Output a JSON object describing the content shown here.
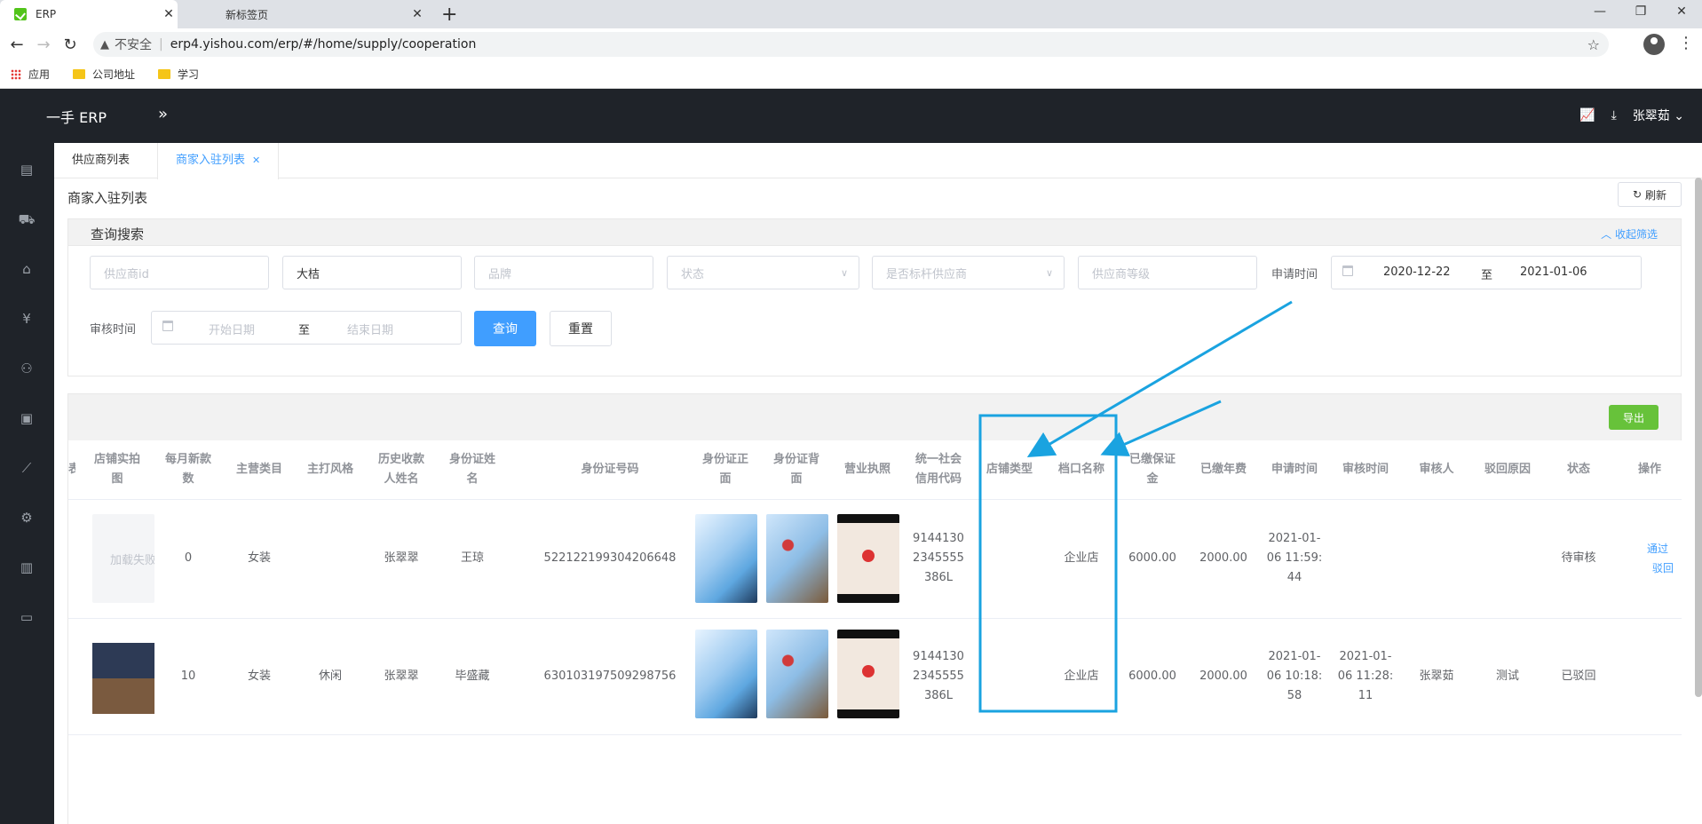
{
  "browser": {
    "tabs": [
      {
        "label": "ERP"
      },
      {
        "label": "新标签页"
      }
    ],
    "address": {
      "security": "不安全",
      "url": "erp4.yishou.com/erp/#/home/supply/cooperation"
    },
    "bookmarks": [
      {
        "label": "应用"
      },
      {
        "label": "公司地址"
      },
      {
        "label": "学习"
      }
    ]
  },
  "app": {
    "logo": "一手 ERP",
    "user": "张翠茹"
  },
  "page_tabs": [
    {
      "label": "供应商列表"
    },
    {
      "label": "商家入驻列表"
    }
  ],
  "page_title": "商家入驻列表",
  "refresh_label": "刷新",
  "search": {
    "title": "查询搜索",
    "collapse_label": "收起筛选",
    "supplier_id_placeholder": "供应商id",
    "name_value": "大桔",
    "brand_placeholder": "品牌",
    "status_placeholder": "状态",
    "benchmark_placeholder": "是否标杆供应商",
    "level_placeholder": "供应商等级",
    "apply_time_label": "申请时间",
    "apply_start": "2020-12-22",
    "apply_end": "2021-01-06",
    "to": "至",
    "review_time_label": "审核时间",
    "review_start_placeholder": "开始日期",
    "review_end_placeholder": "结束日期",
    "query_label": "查询",
    "reset_label": "重置"
  },
  "export_label": "导出",
  "table": {
    "headers": [
      "店铺实拍图",
      "每月新款数",
      "主营类目",
      "主打风格",
      "历史收款人姓名",
      "身份证姓名",
      "身份证号码",
      "身份证正面",
      "身份证背面",
      "营业执照",
      "统一社会信用代码",
      "店铺类型",
      "档口名称",
      "已缴保证金",
      "已缴年费",
      "申请时间",
      "审核时间",
      "审核人",
      "驳回原因",
      "状态",
      "操作"
    ],
    "headers_wrapped": [
      "店铺实拍\n图",
      "每月新款\n数",
      "主营类目",
      "主打风格",
      "历史收款\n人姓名",
      "身份证姓\n名",
      "身份证号码",
      "身份证正\n面",
      "身份证背\n面",
      "营业执照",
      "统一社会\n信用代码",
      "店铺类型",
      "档口名称",
      "已缴保证\n金",
      "已缴年费",
      "申请时间",
      "审核时间",
      "审核人",
      "驳回原因",
      "状态",
      "操作"
    ],
    "rows": [
      {
        "photo_text": "加载失败",
        "monthly": "0",
        "category": "女装",
        "style": "",
        "payee": "张翠翠",
        "id_name": "王琼",
        "id_no": "522122199304206648",
        "credit_code": "91441302345555386L",
        "credit_wrapped": "9144130\n2345555\n386L",
        "store_type": "",
        "stall": "企业店",
        "deposit": "6000.00",
        "fee": "2000.00",
        "apply_time": "2021-01-\n06 11:59:\n44",
        "review_time": "",
        "reviewer": "",
        "reject_reason": "",
        "status": "待审核",
        "actions": [
          "通过",
          "驳回"
        ]
      },
      {
        "photo_text": "",
        "monthly": "10",
        "category": "女装",
        "style": "休闲",
        "payee": "张翠翠",
        "id_name": "毕盛藏",
        "id_no": "630103197509298756",
        "credit_code": "91441302345555386L",
        "credit_wrapped": "9144130\n2345555\n386L",
        "store_type": "",
        "stall": "企业店",
        "deposit": "6000.00",
        "fee": "2000.00",
        "apply_time": "2021-01-\n06 10:18:\n58",
        "review_time": "2021-01-\n06 11:28:\n11",
        "reviewer": "张翠茹",
        "reject_reason": "测试",
        "status": "已驳回",
        "actions": []
      }
    ]
  },
  "colors": {
    "accent": "#409eff",
    "success": "#67c23a",
    "annotation": "#1aa3e0",
    "nav_bg": "#1f2329"
  }
}
